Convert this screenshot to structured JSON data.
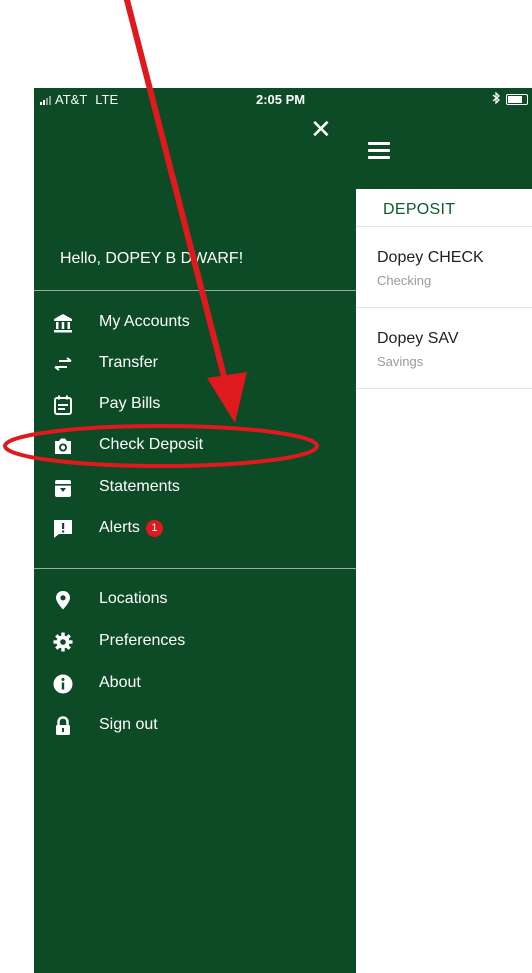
{
  "status_bar": {
    "carrier": "AT&T",
    "network": "LTE",
    "time": "2:05 PM",
    "bluetooth": "bluetooth-icon",
    "battery": "battery-icon"
  },
  "drawer": {
    "greeting": "Hello, DOPEY B DWARF!",
    "primary_items": [
      {
        "label": "My Accounts",
        "icon": "bank-icon"
      },
      {
        "label": "Transfer",
        "icon": "transfer-icon"
      },
      {
        "label": "Pay Bills",
        "icon": "bills-icon"
      },
      {
        "label": "Check Deposit",
        "icon": "camera-icon"
      },
      {
        "label": "Statements",
        "icon": "statements-icon"
      },
      {
        "label": "Alerts",
        "icon": "alert-icon",
        "badge": "1"
      }
    ],
    "secondary_items": [
      {
        "label": "Locations",
        "icon": "location-pin-icon"
      },
      {
        "label": "Preferences",
        "icon": "gear-icon"
      },
      {
        "label": "About",
        "icon": "info-icon"
      },
      {
        "label": "Sign out",
        "icon": "lock-icon"
      }
    ]
  },
  "main": {
    "title": "DEPOSIT",
    "accounts": [
      {
        "name": "Dopey CHECK",
        "type": "Checking"
      },
      {
        "name": "Dopey SAV",
        "type": "Savings"
      }
    ]
  },
  "colors": {
    "brand_green": "#0d4a26",
    "title_green": "#0d5a2e",
    "annotation_red": "#e0191e",
    "badge_red": "#e0191e"
  }
}
